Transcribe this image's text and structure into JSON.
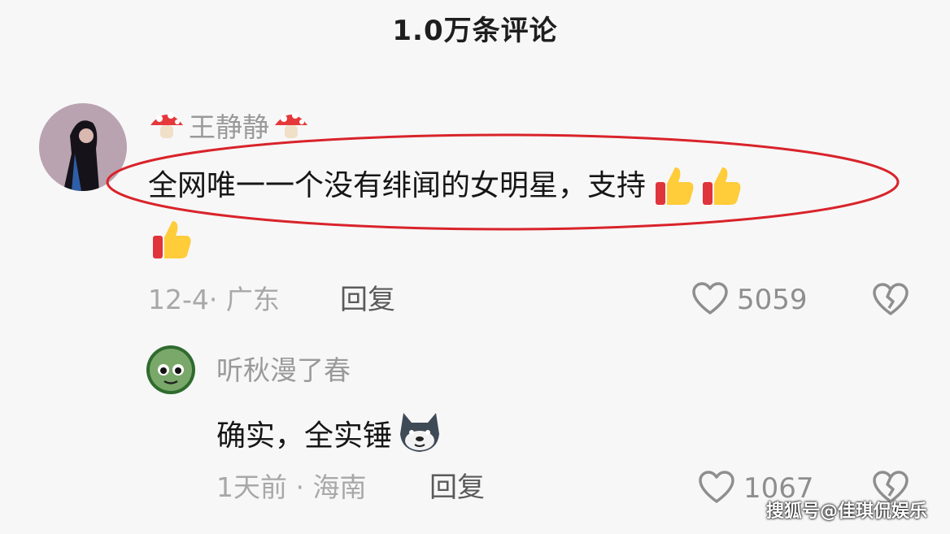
{
  "header": {
    "title": "1.0万条评论"
  },
  "comments": [
    {
      "username": "王静静",
      "text": "全网唯一一个没有绯闻的女明星，支持",
      "meta": "12-4· 广东",
      "reply_label": "回复",
      "likes": "5059"
    },
    {
      "username": "听秋漫了春",
      "text": "确实，全实锤",
      "meta": "1天前 · 海南",
      "reply_label": "回复",
      "likes": "1067"
    }
  ],
  "watermark": "搜狐号@佳琪侃娱乐",
  "colors": {
    "highlight": "#d9232a",
    "background": "#f7f7f7"
  }
}
